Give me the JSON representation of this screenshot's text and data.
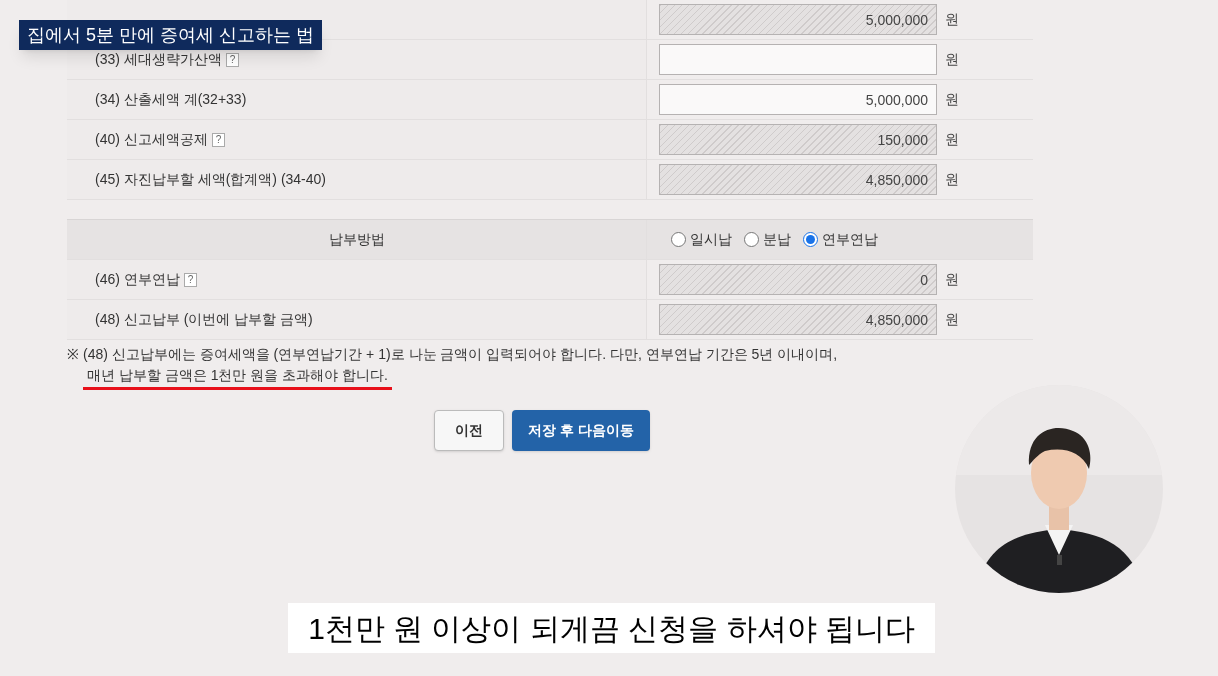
{
  "caption": "집에서 5분 만에 증여세 신고하는 법",
  "rows": [
    {
      "value": "5,000,000",
      "readonly": true,
      "unit": "원"
    },
    {
      "label": "(33) 세대생략가산액",
      "help": "?",
      "readonly": false,
      "unit": "원"
    },
    {
      "label": "(34) 산출세액 계(32+33)",
      "value": "5,000,000",
      "readonly": false,
      "unit": "원"
    },
    {
      "label": "(40) 신고세액공제",
      "help": "?",
      "value": "150,000",
      "readonly": true,
      "unit": "원"
    },
    {
      "label": "(45) 자진납부할 세액(합계액) (34-40)",
      "value": "4,850,000",
      "readonly": true,
      "unit": "원"
    }
  ],
  "payment_method": {
    "label": "납부방법",
    "options": [
      {
        "label": "일시납",
        "selected": false
      },
      {
        "label": "분납",
        "selected": false
      },
      {
        "label": "연부연납",
        "selected": true
      }
    ]
  },
  "payment_rows": [
    {
      "label": "(46) 연부연납",
      "help": "?",
      "value": "0",
      "readonly": true,
      "unit": "원"
    },
    {
      "label": "(48) 신고납부 (이번에 납부할 금액)",
      "value": "4,850,000",
      "readonly": true,
      "unit": "원"
    }
  ],
  "note": {
    "mark": "※",
    "text": "(48) 신고납부에는 증여세액을 (연부연납기간 + 1)로 나눈 금액이 입력되어야 합니다. 다만, 연부연납 기간은 5년 이내이며,",
    "highlight": "매년 납부할 금액은 1천만 원을 초과해야 합니다."
  },
  "buttons": [
    {
      "label": "이전",
      "kind": "secondary"
    },
    {
      "label": "저장 후 다음이동",
      "kind": "primary"
    }
  ],
  "subtitle": "1천만 원 이상이 되게끔 신청을 하셔야 됩니다"
}
